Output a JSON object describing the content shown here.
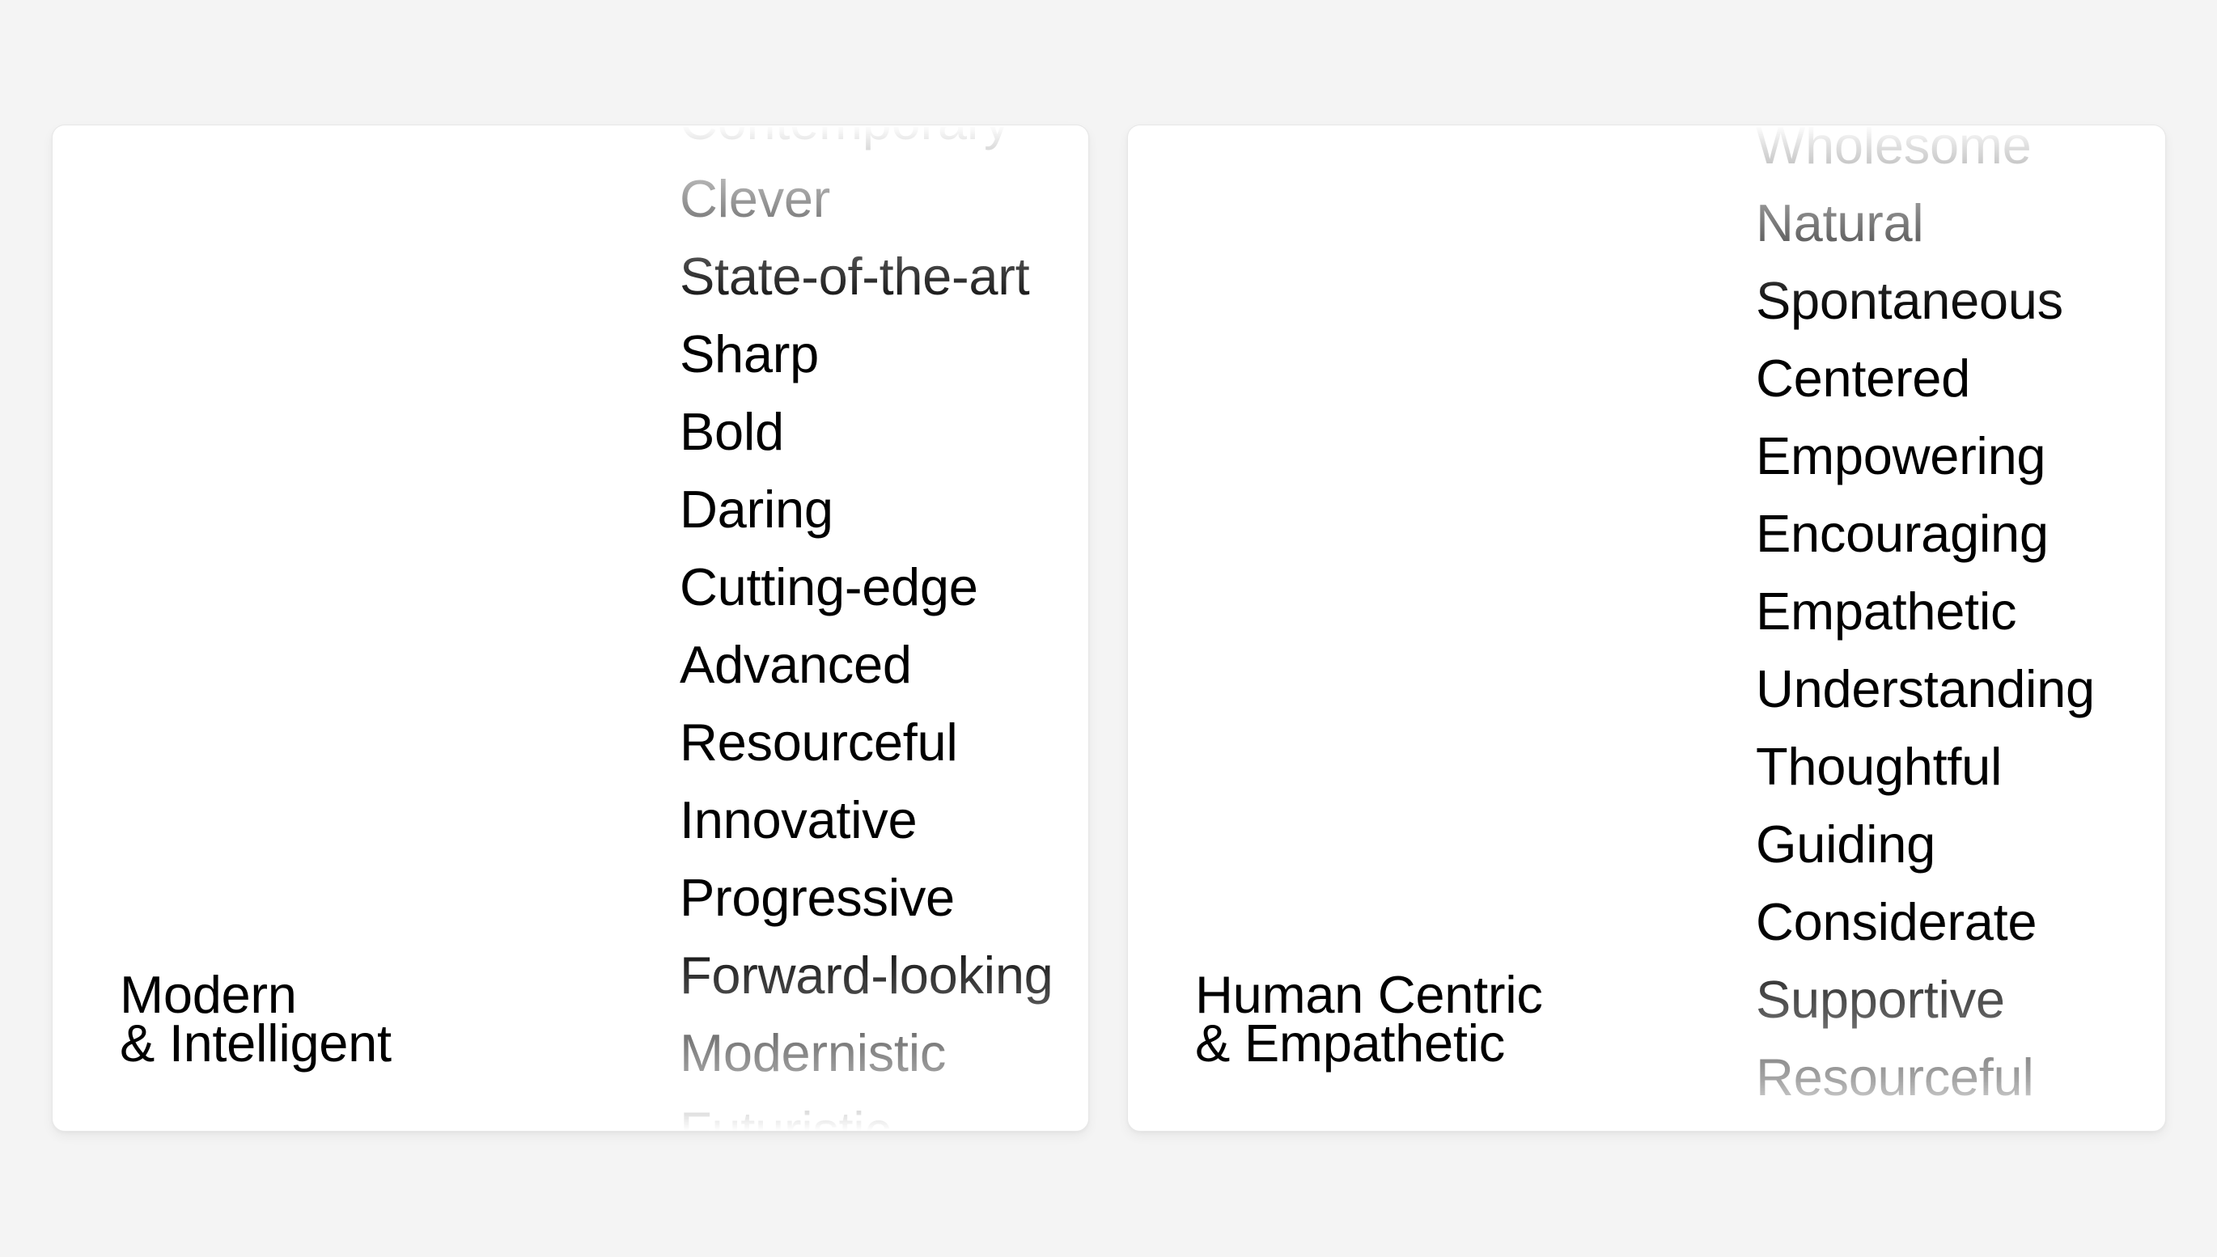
{
  "cards": [
    {
      "title_line1": "Modern",
      "title_line2": "& Intelligent",
      "words": [
        "Contemporary",
        "Clever",
        "State-of-the-art",
        "Sharp",
        "Bold",
        "Daring",
        "Cutting-edge",
        "Advanced",
        "Resourceful",
        "Innovative",
        "Progressive",
        "Forward-looking",
        "Modernistic",
        "Futuristic"
      ]
    },
    {
      "title_line1": "Human Centric",
      "title_line2": "& Empathetic",
      "words": [
        "Wholesome",
        "Natural",
        "Spontaneous",
        "Centered",
        "Empowering",
        "Encouraging",
        "Empathetic",
        "Understanding",
        "Thoughtful",
        "Guiding",
        "Considerate",
        "Supportive",
        "Resourceful"
      ]
    }
  ],
  "colors": {
    "page_background": "#f4f4f4",
    "card_background": "#ffffff",
    "text": "#000000"
  }
}
